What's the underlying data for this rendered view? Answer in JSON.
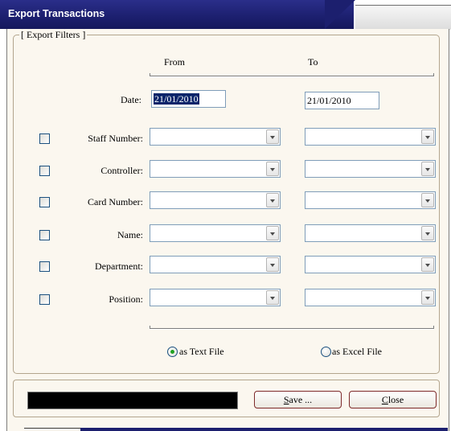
{
  "window": {
    "title": "Export Transactions"
  },
  "filters": {
    "group_label": "[ Export Filters ]",
    "from_label": "From",
    "to_label": "To",
    "date": {
      "label": "Date:",
      "from": "21/01/2010",
      "to": "21/01/2010"
    },
    "rows": [
      {
        "label": "Staff Number:",
        "checked": false,
        "from": "",
        "to": ""
      },
      {
        "label": "Controller:",
        "checked": false,
        "from": "",
        "to": ""
      },
      {
        "label": "Card Number:",
        "checked": false,
        "from": "",
        "to": ""
      },
      {
        "label": "Name:",
        "checked": false,
        "from": "",
        "to": ""
      },
      {
        "label": "Department:",
        "checked": false,
        "from": "",
        "to": ""
      },
      {
        "label": "Position:",
        "checked": false,
        "from": "",
        "to": ""
      }
    ]
  },
  "format": {
    "text_label": "as Text File",
    "excel_label": "as Excel File",
    "selected": "text"
  },
  "actions": {
    "save_label": "ave ...",
    "save_hotkey": "S",
    "close_label": "lose",
    "close_hotkey": "C"
  },
  "colors": {
    "title_bar": "#1c1f6e",
    "dialog_bg": "#fbf7ef",
    "progress": "#000000",
    "date_selection": "#0a246a"
  }
}
